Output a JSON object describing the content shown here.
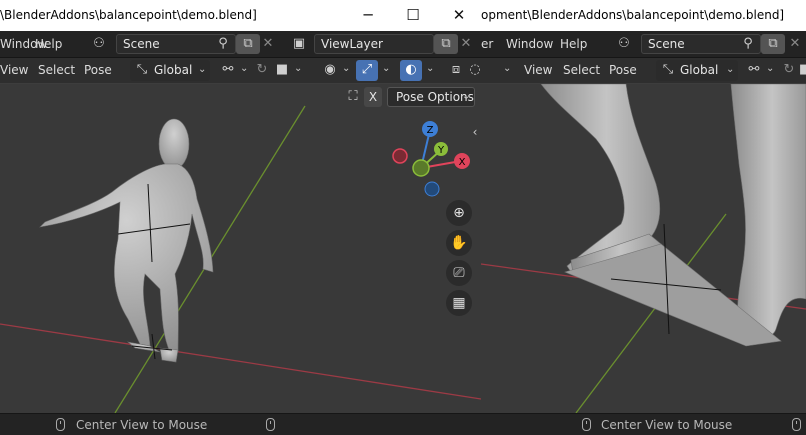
{
  "left": {
    "title": "\\BlenderAddons\\balancepoint\\demo.blend]",
    "window_controls": {
      "minimize": "─",
      "maximize": "☐",
      "close": "✕"
    },
    "topbar": {
      "menus": [
        "Window",
        "Help"
      ],
      "scene_label": "Scene",
      "view_layer_label": "ViewLayer"
    },
    "header": {
      "menus": [
        "View",
        "Select",
        "Pose"
      ],
      "orientation": "Global"
    },
    "pose_options_label": "Pose Options",
    "pose_close_glyph": "X",
    "gizmo": {
      "z": "Z",
      "y": "Y",
      "x": "X"
    },
    "status_text": "Center View to Mouse"
  },
  "right": {
    "title": "opment\\BlenderAddons\\balancepoint\\demo.blend]",
    "topbar": {
      "menus": [
        "er",
        "Window",
        "Help"
      ],
      "scene_label": "Scene"
    },
    "header": {
      "menus": [
        "View",
        "Select",
        "Pose"
      ],
      "orientation": "Global"
    },
    "status_text": "Center View to Mouse"
  },
  "colors": {
    "accent": "#4772b3",
    "axis_x": "#e0445b",
    "axis_y": "#8bbd3a",
    "axis_z": "#3d7fd6",
    "floor_red_line": "#9c3a45",
    "floor_green_line": "#6a8f2e"
  },
  "icons": [
    "scene-icon",
    "pin-icon",
    "copy-icon",
    "close-icon",
    "viewlayer-icon",
    "orientation-icon",
    "snap-icon",
    "proportional-icon",
    "visibility-icon",
    "gizmo-icon",
    "overlay-icon",
    "xray-icon",
    "zoom-icon",
    "pan-icon",
    "camera-icon",
    "grid-icon",
    "collapse-icon",
    "mouse-icon"
  ]
}
